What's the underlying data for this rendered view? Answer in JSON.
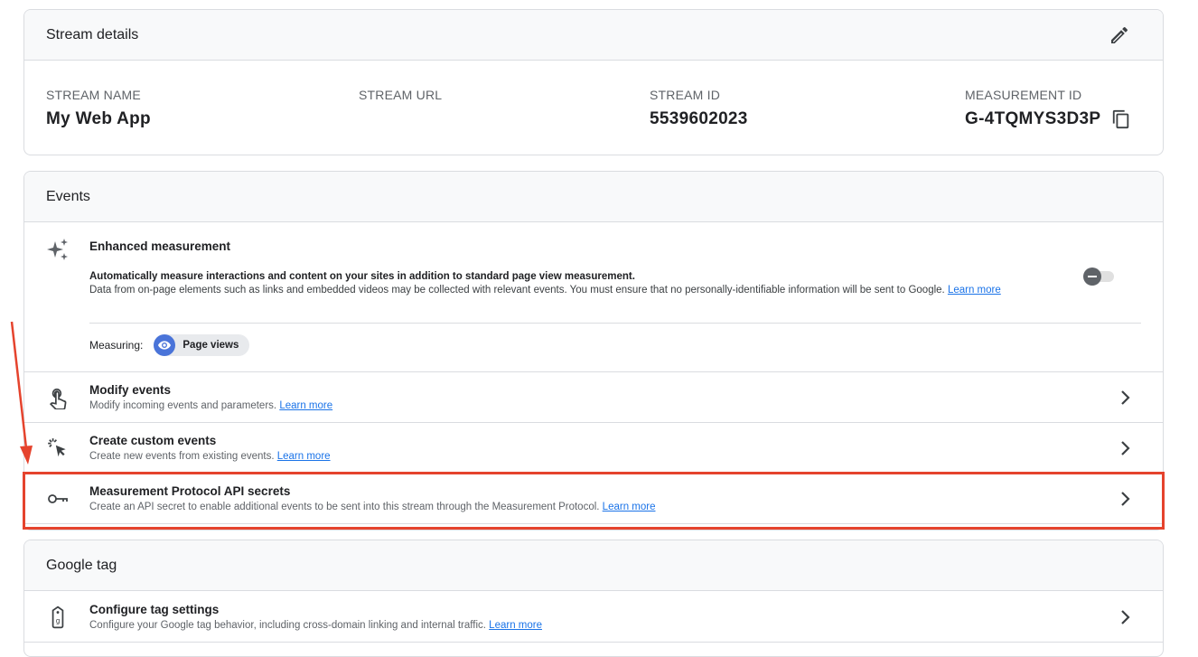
{
  "stream_details": {
    "title": "Stream details",
    "fields": [
      {
        "label": "STREAM NAME",
        "value": "My Web App"
      },
      {
        "label": "STREAM URL",
        "value": ""
      },
      {
        "label": "STREAM ID",
        "value": "5539602023"
      },
      {
        "label": "MEASUREMENT ID",
        "value": "G-4TQMYS3D3P"
      }
    ]
  },
  "events": {
    "title": "Events",
    "enhanced": {
      "title": "Enhanced measurement",
      "desc_bold": "Automatically measure interactions and content on your sites in addition to standard page view measurement.",
      "desc": "Data from on-page elements such as links and embedded videos may be collected with relevant events. You must ensure that no personally-identifiable information will be sent to Google.",
      "learn_more": "Learn more",
      "measuring_label": "Measuring:",
      "chip": "Page views",
      "toggle_state": "off"
    },
    "rows": [
      {
        "title": "Modify events",
        "subtitle": "Modify incoming events and parameters.",
        "learn_more": "Learn more",
        "icon": "touch-icon"
      },
      {
        "title": "Create custom events",
        "subtitle": "Create new events from existing events.",
        "learn_more": "Learn more",
        "icon": "cursor-click-icon"
      },
      {
        "title": "Measurement Protocol API secrets",
        "subtitle": "Create an API secret to enable additional events to be sent into this stream through the Measurement Protocol.",
        "learn_more": "Learn more",
        "icon": "key-icon"
      }
    ]
  },
  "google_tag": {
    "title": "Google tag",
    "rows": [
      {
        "title": "Configure tag settings",
        "subtitle": "Configure your Google tag behavior, including cross-domain linking and internal traffic.",
        "learn_more": "Learn more",
        "icon": "tag-icon"
      }
    ]
  },
  "colors": {
    "highlight": "#e5432d",
    "link": "#1a73e8",
    "chip_icon": "#4a74d9"
  }
}
